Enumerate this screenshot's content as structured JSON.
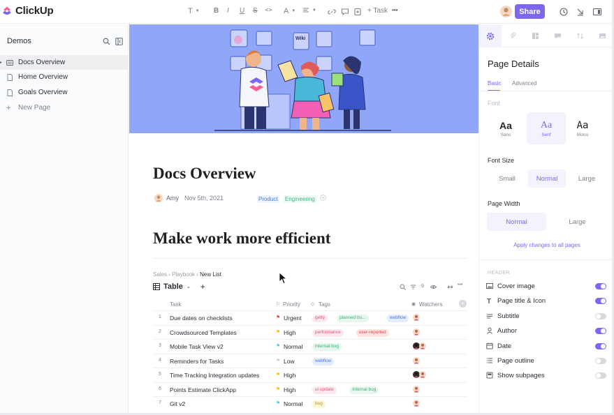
{
  "app": {
    "brand": "ClickUp",
    "accent": "#7b68ee"
  },
  "toolbar": {
    "text_style": "T",
    "bold": "B",
    "italic": "I",
    "underline": "U",
    "strike": "S",
    "code": "<>",
    "font_color": "A",
    "add_task": "+ Task",
    "more": "•••",
    "share_label": "Share"
  },
  "sidebar": {
    "workspace": "Demos",
    "items": [
      {
        "label": "Docs Overview",
        "active": true
      },
      {
        "label": "Home Overview",
        "active": false
      },
      {
        "label": "Goals Overview",
        "active": false
      }
    ],
    "new_page": "New Page"
  },
  "doc": {
    "title": "Docs Overview",
    "author": "Amy",
    "date": "Nov 5th, 2021",
    "tags": [
      "Product",
      "Engineering"
    ],
    "heading": "Make work more efficient",
    "breadcrumb": [
      "Sales",
      "Playbook",
      "New List"
    ],
    "view_label": "Table",
    "filter_count": "9"
  },
  "table": {
    "columns": [
      "Task",
      "Priority",
      "Tags",
      "Watchers"
    ],
    "rows": [
      {
        "num": "1",
        "task": "Due dates on checklists",
        "priority": "Urgent",
        "tags": [
          "getty",
          "planned bu...",
          "webflow"
        ]
      },
      {
        "num": "2",
        "task": "Crowdsourced Templates",
        "priority": "High",
        "tags": [
          "performance",
          "user-reported"
        ]
      },
      {
        "num": "3",
        "task": "Mobile Task View v2",
        "priority": "Normal",
        "tags": [
          "internal bug"
        ]
      },
      {
        "num": "4",
        "task": "Reminders for Tasks",
        "priority": "Low",
        "tags": [
          "webflow"
        ]
      },
      {
        "num": "5",
        "task": "Time Tracking Integration updates",
        "priority": "High",
        "tags": []
      },
      {
        "num": "6",
        "task": "Points Estimate ClickApp",
        "priority": "High",
        "tags": [
          "ui update",
          "internal bug"
        ]
      },
      {
        "num": "7",
        "task": "Git v2",
        "priority": "Normal",
        "tags": [
          "bug"
        ]
      }
    ]
  },
  "panel": {
    "title": "Page Details",
    "tabs": [
      "Basic",
      "Advanced"
    ],
    "font_label": "Font",
    "fonts": [
      {
        "sample": "Aa",
        "name": "Sans"
      },
      {
        "sample": "Aa",
        "name": "Serif"
      },
      {
        "sample": "Aa",
        "name": "Mono"
      }
    ],
    "font_size_label": "Font Size",
    "font_sizes": [
      "Small",
      "Normal",
      "Large"
    ],
    "page_width_label": "Page Width",
    "page_widths": [
      "Normal",
      "Large"
    ],
    "apply_label": "Apply changes to all pages",
    "header_label": "HEADER",
    "toggles": [
      {
        "label": "Cover image",
        "on": true
      },
      {
        "label": "Page title & Icon",
        "on": true
      },
      {
        "label": "Subtitle",
        "on": false
      },
      {
        "label": "Author",
        "on": true
      },
      {
        "label": "Date",
        "on": true
      },
      {
        "label": "Page outline",
        "on": false
      },
      {
        "label": "Show subpages",
        "on": false
      }
    ]
  }
}
